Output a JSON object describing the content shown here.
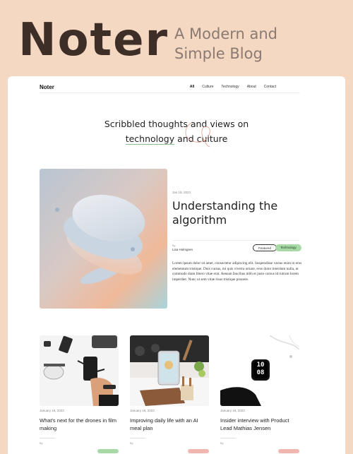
{
  "hero": {
    "brand": "Noter",
    "tagline": "A Modern  and Simple Blog"
  },
  "nav": {
    "logo": "Noter",
    "links": [
      "All",
      "Culture",
      "Technology",
      "About",
      "Contact"
    ],
    "active": "All"
  },
  "intro": {
    "line1": "Scribbled thoughts and views on",
    "line2_word1": "technology",
    "line2_mid": " and ",
    "line2_word2": "culture"
  },
  "featured": {
    "date": "Jan 18, 2023",
    "title": "Understanding the algorithm",
    "by_label": "By",
    "author": "Lisa Holmgren",
    "tags": [
      "Featured",
      "Technology"
    ],
    "body": "Lorem ipsum dolor sit amet, consectetur adipiscing elit. Suspendisse varius enim in eros elementum tristique. Duis cursus, mi quis viverra ornare, eros dolor interdum nulla, ut commodo diam libero vitae erat. Aenean faucibus nibh et justo cursus id rutrum lorem imperdiet. Nunc ut sem vitae risus tristique posuere."
  },
  "posts": [
    {
      "date": "January 18, 2022",
      "title": "What's next for the drones in film making",
      "by_label": "By",
      "tag_color": "#a7d9a7"
    },
    {
      "date": "January 18, 2022",
      "title": "Improving daily life with an AI meal plan",
      "by_label": "By",
      "tag_color": "#f2b6b0"
    },
    {
      "date": "January 18, 2022",
      "title": "Insider interview with Product Lead Mathias Jensen",
      "by_label": "By",
      "tag_color": "#f2b6b0"
    }
  ],
  "watch_face": {
    "top": "10",
    "bottom": "08"
  },
  "colors": {
    "page_bg": "#f5d8c2",
    "brand": "#3d2e28",
    "tagline": "#8a7a72",
    "tech_pill": "#a7d9a7",
    "pink_pill": "#f2b6b0"
  }
}
